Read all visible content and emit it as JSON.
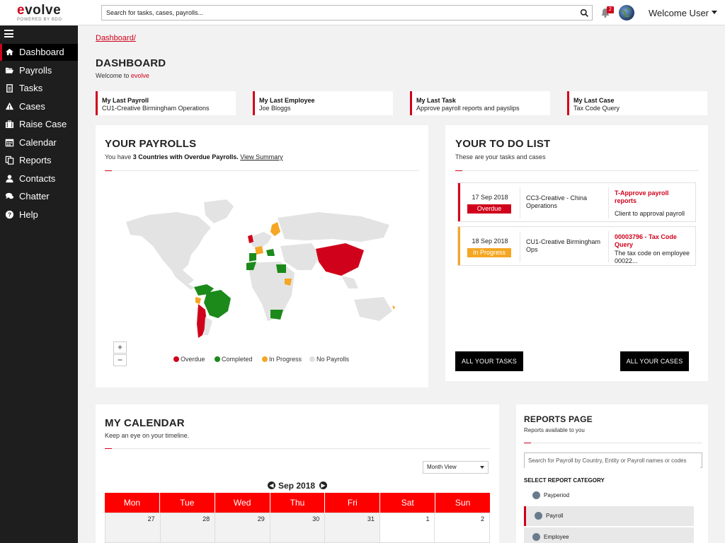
{
  "app": {
    "logo_name": "evolve",
    "logo_tagline": "POWERED BY BDO"
  },
  "header": {
    "search_placeholder": "Search for tasks, cases, payrolls...",
    "notification_count": "2",
    "welcome": "Welcome User"
  },
  "sidebar": {
    "items": [
      {
        "label": "Dashboard",
        "icon": "home-icon",
        "active": true
      },
      {
        "label": "Payrolls",
        "icon": "folder-open-icon"
      },
      {
        "label": "Tasks",
        "icon": "clipboard-icon"
      },
      {
        "label": "Cases",
        "icon": "warning-icon"
      },
      {
        "label": "Raise Case",
        "icon": "briefcase-icon"
      },
      {
        "label": "Calendar",
        "icon": "calendar-icon"
      },
      {
        "label": "Reports",
        "icon": "copy-icon"
      },
      {
        "label": "Contacts",
        "icon": "user-icon"
      },
      {
        "label": "Chatter",
        "icon": "comments-icon"
      },
      {
        "label": "Help",
        "icon": "question-circle-icon"
      }
    ]
  },
  "breadcrumb": "Dashboard/",
  "page": {
    "title": "DASHBOARD",
    "subtitle_prefix": "Welcome to ",
    "subtitle_brand": "evolve"
  },
  "quick_links": [
    {
      "title": "My Last Payroll",
      "value": "CU1-Creative Birmingham Operations"
    },
    {
      "title": "My Last Employee",
      "value": "Joe Bloggs"
    },
    {
      "title": "My Last Task",
      "value": "Approve payroll reports and payslips"
    },
    {
      "title": "My Last Case",
      "value": "Tax Code Query"
    }
  ],
  "payrolls": {
    "title": "YOUR PAYROLLS",
    "sub_prefix": "You have ",
    "sub_bold": "3 Countries with Overdue Payrolls.",
    "sub_link": "View Summary",
    "zoom_in": "+",
    "zoom_out": "−",
    "legend": [
      {
        "label": "Overdue",
        "color": "#d0021b"
      },
      {
        "label": "Completed",
        "color": "#1b8a1b"
      },
      {
        "label": "In Progress",
        "color": "#f5a623"
      },
      {
        "label": "No Payrolls",
        "color": "#e0e0e0"
      }
    ]
  },
  "todo": {
    "title": "YOUR TO DO LIST",
    "subtitle": "These are your tasks and cases",
    "items": [
      {
        "date": "17 Sep 2018",
        "status": "Overdue",
        "status_color": "#d0021b",
        "entity": "CC3-Creative - China Operations",
        "task": "T-Approve payroll reports",
        "desc": "Client to approval payroll"
      },
      {
        "date": "18 Sep 2018",
        "status": "In Progress",
        "status_color": "#f5a623",
        "entity": "CU1-Creative Birmingham Ops",
        "task": "00003796 - Tax Code Query",
        "desc": "The tax code on employee 00022..."
      }
    ],
    "all_tasks": "ALL YOUR TASKS",
    "all_cases": "ALL YOUR CASES"
  },
  "calendar": {
    "title": "MY CALENDAR",
    "subtitle": "Keep an eye on your timeline.",
    "view": "Month View",
    "month": "Sep 2018",
    "days": [
      "Mon",
      "Tue",
      "Wed",
      "Thu",
      "Fri",
      "Sat",
      "Sun"
    ],
    "first_row": [
      "27",
      "28",
      "29",
      "30",
      "31",
      "1",
      "2"
    ]
  },
  "reports": {
    "title": "REPORTS PAGE",
    "subtitle": "Reports available to you",
    "search_placeholder": "Search for Payroll by Country, Entity or Payroll names or codes",
    "category_title": "SELECT REPORT CATEGORY",
    "categories": [
      "Payperiod",
      "Payroll",
      "Employee"
    ]
  }
}
